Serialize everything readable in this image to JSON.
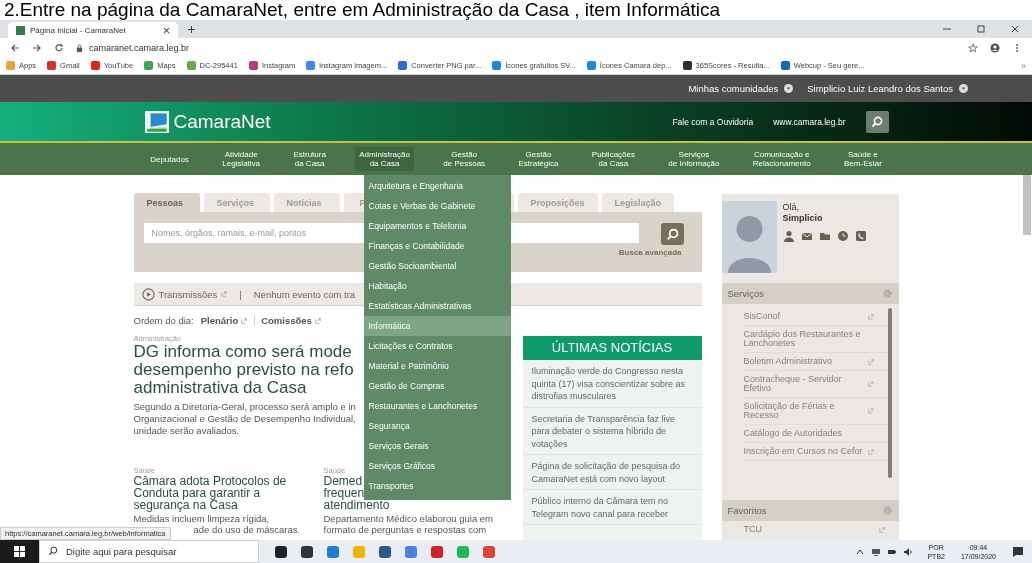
{
  "caption": "2.Entre na página da CamaraNet, entre em Administração da Casa , item Informática",
  "browser": {
    "tab_title": "Página Inicial - CamaraNet",
    "url": "camaranet.camara.leg.br",
    "bookmarks": [
      {
        "label": "Apps",
        "color": "#e8a33a"
      },
      {
        "label": "Gmail",
        "color": "#d93025"
      },
      {
        "label": "YouTube",
        "color": "#e62117"
      },
      {
        "label": "Maps",
        "color": "#34a853"
      },
      {
        "label": "DC-295441",
        "color": "#6aa84f"
      },
      {
        "label": "Instagram",
        "color": "#c13584"
      },
      {
        "label": "instagram imagem...",
        "color": "#4285f4"
      },
      {
        "label": "Converter PNG par...",
        "color": "#2d6cdf"
      },
      {
        "label": "Ícones gratuitos SV...",
        "color": "#1e88e5"
      },
      {
        "label": "Ícones Camara dep...",
        "color": "#1e88e5"
      },
      {
        "label": "365Scores - Resulta...",
        "color": "#263238"
      },
      {
        "label": "Webcup - Seu gere...",
        "color": "#1565c0"
      }
    ],
    "more": "»"
  },
  "top_bar": {
    "communities": "Minhas comunidades",
    "user": "Simplicio Luiz Leandro dos Santos"
  },
  "header": {
    "logo": "CamaraNet",
    "ombudsman": "Fale com a Ouvidoria",
    "site": "www.camara.leg.br"
  },
  "nav": [
    {
      "label": "Deputados",
      "expanded": false
    },
    {
      "label": "Atividade\nLegislativa",
      "expanded": false
    },
    {
      "label": "Estrutura\nda Casa",
      "expanded": false
    },
    {
      "label": "Administração\nda Casa",
      "expanded": true
    },
    {
      "label": "Gestão\nde Pessoas",
      "expanded": false
    },
    {
      "label": "Gestão\nEstratégica",
      "expanded": false
    },
    {
      "label": "Publicações\nda Casa",
      "expanded": false
    },
    {
      "label": "Serviços\nde Informação",
      "expanded": false
    },
    {
      "label": "Comunicação e\nRelacionamento",
      "expanded": false
    },
    {
      "label": "Saúde e\nBem-Estar",
      "expanded": false
    }
  ],
  "menu": [
    {
      "label": "Arquitetura e Engenharia",
      "selected": false
    },
    {
      "label": "Cotas e Verbas de Gabinete",
      "selected": false
    },
    {
      "label": "Equipamentos e Telefonia",
      "selected": false
    },
    {
      "label": "Finanças e Contabilidade",
      "selected": false
    },
    {
      "label": "Gestão Socioambiental",
      "selected": false
    },
    {
      "label": "Habitação",
      "selected": false
    },
    {
      "label": "Estatísticas Administrativas",
      "selected": false
    },
    {
      "label": "Informática",
      "selected": true
    },
    {
      "label": "Licitações e Contratos",
      "selected": false
    },
    {
      "label": "Material e Patrimônio",
      "selected": false
    },
    {
      "label": "Gestão de Compras",
      "selected": false
    },
    {
      "label": "Restaurantes e Lanchonetes",
      "selected": false
    },
    {
      "label": "Segurança",
      "selected": false
    },
    {
      "label": "Serviços Gerais",
      "selected": false
    },
    {
      "label": "Serviços Gráficos",
      "selected": false
    },
    {
      "label": "Transportes",
      "selected": false
    }
  ],
  "search": {
    "tabs": [
      {
        "label": "Pessoas",
        "selected": true
      },
      {
        "label": "Serviços",
        "selected": false
      },
      {
        "label": "Notícias",
        "selected": false
      },
      {
        "label": "P",
        "selected": false
      },
      {
        "label": "Proposições",
        "selected": false
      },
      {
        "label": "Legislação",
        "selected": false
      }
    ],
    "placeholder": "Nomes, órgãos, ramais, e-mail, pontos",
    "advanced": "Busca avançada"
  },
  "transmissions": {
    "label": "Transmissões",
    "separator": "|",
    "event": "Nenhum evento com tra"
  },
  "agenda": {
    "label": "Ordem do dia:",
    "links": [
      "Plenário",
      "Comissões"
    ]
  },
  "featured": {
    "section": "Administração",
    "headline_lines": [
      "DG informa como será mode",
      "desempenho previsto na refo",
      "administrativa da Casa"
    ],
    "summary_lines": [
      "Segundo a Diretoria-Geral, processo será amplo e in",
      "Organizacional e Gestão de Desempenho Individual,",
      "unidade serão avaliados."
    ]
  },
  "articles": [
    {
      "section": "Saúde",
      "title_lines": [
        "Câmara adota Protocolos de",
        "Conduta para garantir a",
        "segurança na Casa"
      ],
      "text_lines": [
        "Medidas incluem limpeza rígida,",
        "ade do uso de máscaras."
      ]
    },
    {
      "section": "Saúde",
      "title_lines": [
        "Demed",
        "frequen",
        "atendimento"
      ],
      "text_lines": [
        "Departamento Médico elaborou guia em",
        "formato de perguntas e respostas com"
      ]
    }
  ],
  "news": {
    "title": "ÚLTIMAS NOTÍCIAS",
    "items": [
      "Iluminação verde do Congresso nesta quinta (17) visa conscientizar sobre as distrofias musculares",
      "Secretaria de Transparência faz live para debater o sistema híbrido de votações",
      "Página de solicitação de pesquisa do CamaraNet está com novo layout",
      "Público interno da Câmara tem no Telegram novo canal para receber"
    ]
  },
  "profile": {
    "greeting": "Olá,",
    "name": "Simplicio"
  },
  "services": {
    "title": "Serviços",
    "items": [
      {
        "label": "SisConof",
        "external": true
      },
      {
        "label": "Cardápio dos Restaurantes e Lanchonetes",
        "external": false
      },
      {
        "label": "Boletim Administrativo",
        "external": true
      },
      {
        "label": "Contracheque - Servidor Efetivo",
        "external": true
      },
      {
        "label": "Solicitação de Férias e Recesso",
        "external": true
      },
      {
        "label": "Catálogo de Autoridades",
        "external": false
      },
      {
        "label": "Inscrição em Cursos no Cefor",
        "external": true
      }
    ]
  },
  "favorites": {
    "title": "Favoritos",
    "items": [
      {
        "label": "TCU",
        "external": true
      }
    ]
  },
  "status_url": "https://camaranet.camara.leg.br/web/informatica",
  "taskbar": {
    "search_placeholder": "Digite aqui para pesquisar",
    "apps": [
      {
        "color": "#222222"
      },
      {
        "color": "#333333"
      },
      {
        "color": "#1f7bd6"
      },
      {
        "color": "#f0b400"
      },
      {
        "color": "#2b5797"
      },
      {
        "color": "#4a7fe0"
      },
      {
        "color": "#d3232a"
      },
      {
        "color": "#1db954"
      },
      {
        "color": "#db4437"
      }
    ],
    "language": "POR",
    "layout": "PTB2",
    "time": "09:44",
    "date": "17/09/2020"
  }
}
